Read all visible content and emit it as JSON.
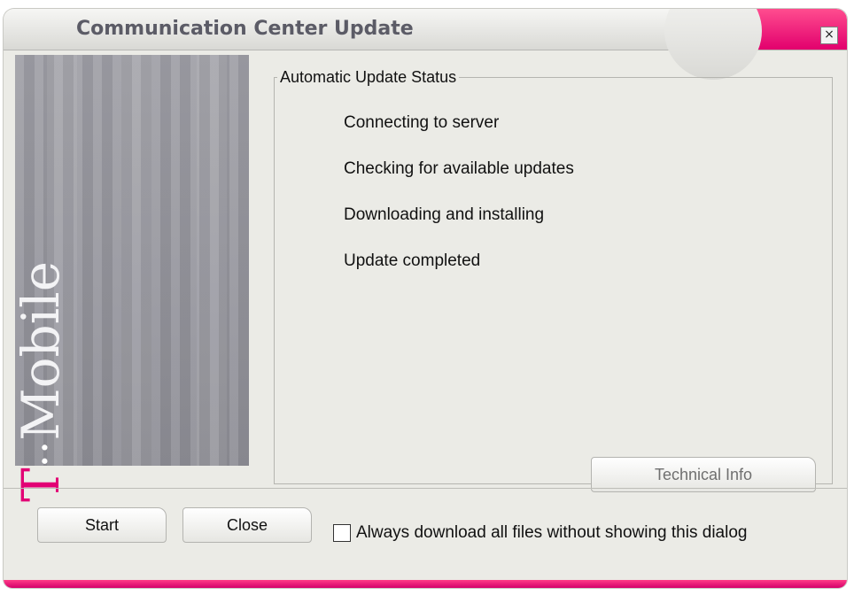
{
  "window": {
    "title": "Communication Center Update",
    "close_glyph": "×",
    "accent_color": "#e20074"
  },
  "banner": {
    "brand_t": "T",
    "brand_dots": "··",
    "brand_name": "Mobile"
  },
  "status": {
    "legend": "Automatic Update Status",
    "steps": [
      "Connecting to server",
      "Checking for available updates",
      "Downloading and installing",
      "Update completed"
    ],
    "technical_info_label": "Technical Info"
  },
  "footer": {
    "start_label": "Start",
    "close_label": "Close",
    "always_download_label": "Always download all files without showing this dialog",
    "always_download_checked": false
  }
}
